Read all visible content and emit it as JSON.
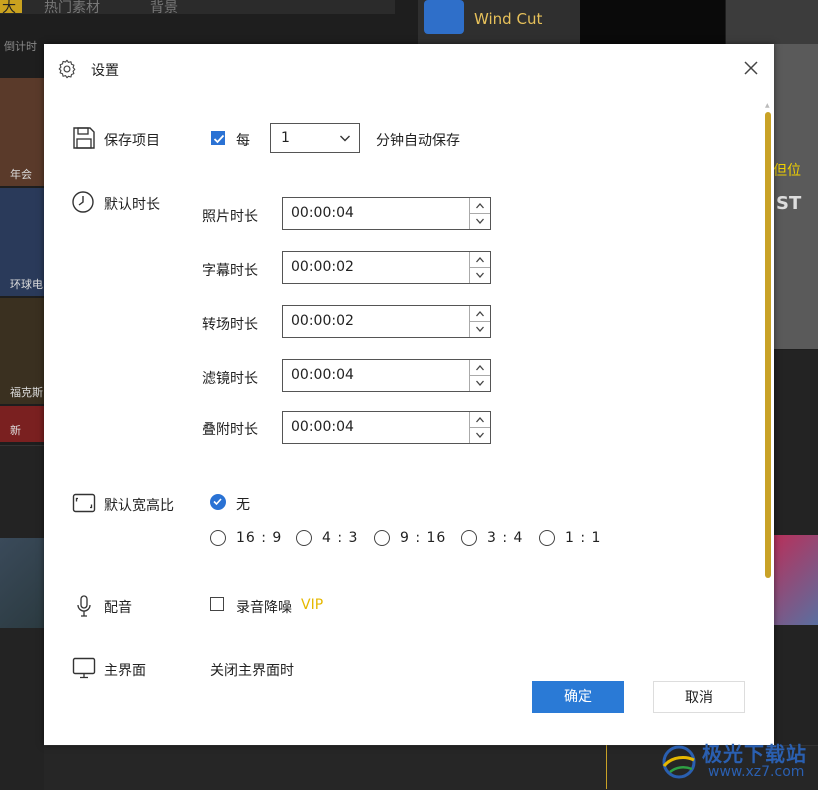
{
  "background": {
    "tabs": [
      "大",
      "热门素材",
      "背景"
    ],
    "countdown_label": "倒计时",
    "thumbs": [
      {
        "label": "年会",
        "color": "#5a3a2a"
      },
      {
        "label": "环球电",
        "color": "#2a3a5a"
      },
      {
        "label": "福克斯电",
        "color": "#3a3020"
      },
      {
        "label": "新",
        "color": "#7a2020"
      }
    ],
    "app_logo_text": "Wind Cut",
    "preview_caption": "但位",
    "preview_text": "ST"
  },
  "dialog": {
    "title": "设置",
    "autosave": {
      "label": "保存项目",
      "checkbox_label": "每",
      "checked": true,
      "interval_value": "1",
      "suffix": "分钟自动保存"
    },
    "default_duration": {
      "label": "默认时长",
      "rows": [
        {
          "label": "照片时长",
          "value": "00:00:04"
        },
        {
          "label": "字幕时长",
          "value": "00:00:02"
        },
        {
          "label": "转场时长",
          "value": "00:00:02"
        },
        {
          "label": "滤镜时长",
          "value": "00:00:04"
        },
        {
          "label": "叠附时长",
          "value": "00:00:04"
        }
      ]
    },
    "aspect_ratio": {
      "label": "默认宽高比",
      "selected_label": "无",
      "options": [
        "16 : 9",
        "4 : 3",
        "9 : 16",
        "3 : 4",
        "1 : 1"
      ]
    },
    "audio": {
      "label": "配音",
      "checkbox_label": "录音降噪",
      "checked": false,
      "badge": "VIP"
    },
    "main_ui": {
      "label": "主界面",
      "option_text": "关闭主界面时"
    },
    "ok_label": "确定",
    "cancel_label": "取消"
  },
  "watermark": {
    "title": "极光下载站",
    "url": "www.xz7.com"
  },
  "colors": {
    "accent": "#2a7ad6",
    "vip": "#e6b800",
    "scrollbar": "#c9a227"
  }
}
